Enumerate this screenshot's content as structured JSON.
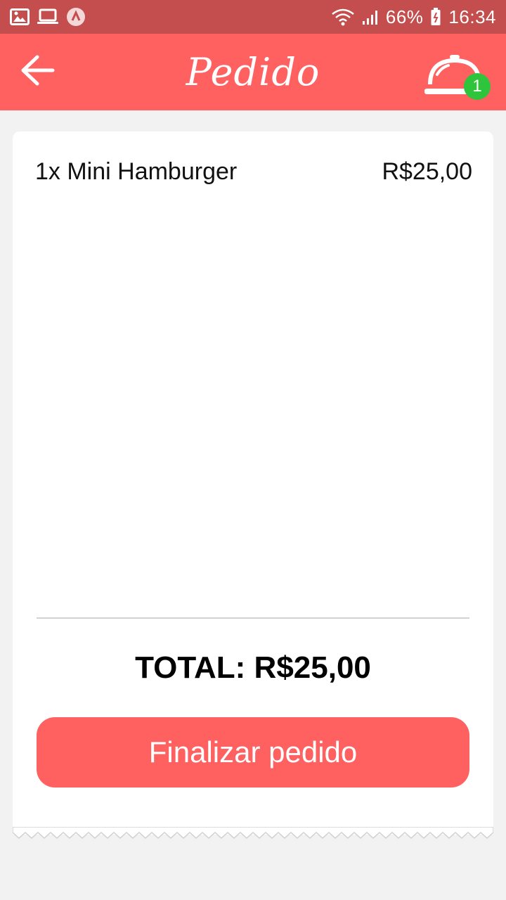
{
  "status_bar": {
    "battery": "66%",
    "time": "16:34",
    "icons": [
      "image-icon",
      "laptop-icon",
      "app-notification-icon",
      "wifi-icon",
      "signal-icon",
      "battery-icon"
    ]
  },
  "header": {
    "title": "Pedido",
    "back_icon": "arrow-left-icon",
    "cart_icon": "service-bell-icon",
    "cart_badge": "1"
  },
  "order": {
    "items": [
      {
        "label": "1x Mini Hamburger",
        "price": "R$25,00"
      }
    ],
    "total_label": "TOTAL: R$25,00",
    "finalize_label": "Finalizar pedido"
  },
  "colors": {
    "status_bar": "#c44d4d",
    "header": "#ff6060",
    "badge": "#2ec43c",
    "background": "#f2f2f2"
  }
}
